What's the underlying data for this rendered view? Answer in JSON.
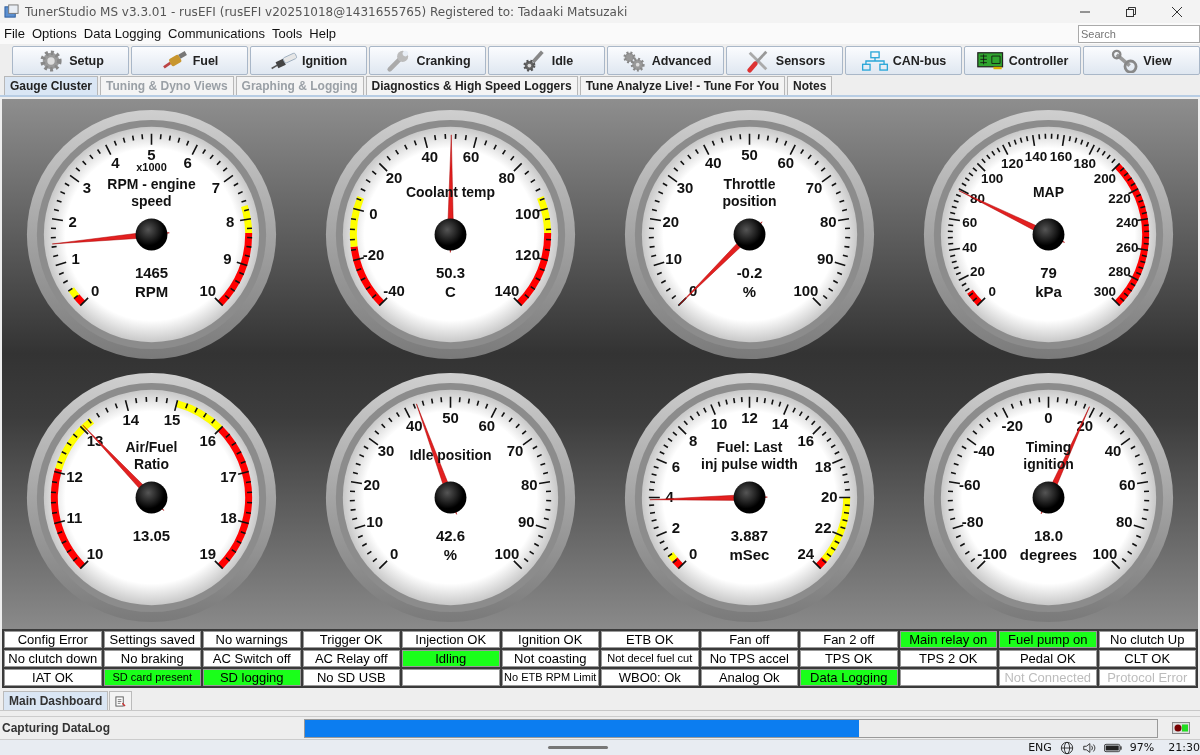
{
  "window": {
    "title": "TunerStudio MS v3.3.01 - rusEFI (rusEFI v20251018@1431655765) Registered to: Tadaaki Matsuzaki"
  },
  "menu": [
    "File",
    "Options",
    "Data Logging",
    "Communications",
    "Tools",
    "Help"
  ],
  "search": {
    "placeholder": "Search"
  },
  "toolbar": [
    {
      "label": "Setup",
      "kind": "gear"
    },
    {
      "label": "Fuel",
      "kind": "injector"
    },
    {
      "label": "Ignition",
      "kind": "sparkplug"
    },
    {
      "label": "Cranking",
      "kind": "wrench"
    },
    {
      "label": "Idle",
      "kind": "wrenchgear"
    },
    {
      "label": "Advanced",
      "kind": "gears"
    },
    {
      "label": "Sensors",
      "kind": "tools"
    },
    {
      "label": "CAN-bus",
      "kind": "network"
    },
    {
      "label": "Controller",
      "kind": "board"
    },
    {
      "label": "View",
      "kind": "conrod"
    }
  ],
  "tabs": [
    {
      "label": "Gauge Cluster",
      "selected": true,
      "disabled": false
    },
    {
      "label": "Tuning & Dyno Views",
      "selected": false,
      "disabled": true
    },
    {
      "label": "Graphing & Logging",
      "selected": false,
      "disabled": true
    },
    {
      "label": "Diagnostics & High Speed Loggers",
      "selected": false,
      "disabled": false
    },
    {
      "label": "Tune Analyze Live! - Tune For You",
      "selected": false,
      "disabled": false
    },
    {
      "label": "Notes",
      "selected": false,
      "disabled": false
    }
  ],
  "gauges": [
    {
      "subtitle": "x1000",
      "lines": [
        "RPM - engine",
        "speed"
      ],
      "value": "1465",
      "unit": "RPM",
      "scale": [
        "0",
        "1",
        "2",
        "3",
        "4",
        "5",
        "6",
        "7",
        "8",
        "9",
        "10"
      ]
    },
    {
      "lines": [
        "Coolant temp"
      ],
      "value": "50.3",
      "unit": "C",
      "scale": [
        "-40",
        "-20",
        "0",
        "20",
        "40",
        "60",
        "80",
        "100",
        "120",
        "140"
      ]
    },
    {
      "lines": [
        "Throttle",
        "position"
      ],
      "value": "-0.2",
      "unit": "%",
      "scale": [
        "0",
        "10",
        "20",
        "30",
        "40",
        "50",
        "60",
        "70",
        "80",
        "90",
        "100"
      ]
    },
    {
      "lines": [
        "MAP"
      ],
      "value": "79",
      "unit": "kPa",
      "scale": [
        "0",
        "20",
        "40",
        "60",
        "80",
        "100",
        "120",
        "140",
        "160",
        "180",
        "200",
        "220",
        "240",
        "260",
        "280",
        "300"
      ]
    },
    {
      "lines": [
        "Air/Fuel",
        "Ratio"
      ],
      "value": "13.05",
      "scale": [
        "10",
        "11",
        "12",
        "13",
        "14",
        "15",
        "16",
        "17",
        "18",
        "19"
      ]
    },
    {
      "lines": [
        "Idle position"
      ],
      "value": "42.6",
      "unit": "%",
      "scale": [
        "0",
        "10",
        "20",
        "30",
        "40",
        "50",
        "60",
        "70",
        "80",
        "90",
        "100"
      ]
    },
    {
      "lines": [
        "Fuel: Last",
        "inj pulse width"
      ],
      "value": "3.887",
      "unit": "mSec",
      "scale": [
        "0",
        "2",
        "4",
        "6",
        "8",
        "10",
        "12",
        "14",
        "16",
        "18",
        "20",
        "22",
        "24"
      ]
    },
    {
      "lines": [
        "Timing",
        "ignition"
      ],
      "value": "18.0",
      "unit": "degrees",
      "scale": [
        "-100",
        "-80",
        "-60",
        "-40",
        "-20",
        "0",
        "20",
        "40",
        "60",
        "80",
        "100"
      ]
    }
  ],
  "indicators": [
    {
      "cells": [
        {
          "text": "Config Error",
          "on": false,
          "disabled": false
        },
        {
          "text": "Settings saved",
          "on": false,
          "disabled": false
        },
        {
          "text": "No warnings",
          "on": false,
          "disabled": false
        },
        {
          "text": "Trigger OK",
          "on": false,
          "disabled": false
        },
        {
          "text": "Injection OK",
          "on": false,
          "disabled": false
        },
        {
          "text": "Ignition OK",
          "on": false,
          "disabled": false
        },
        {
          "text": "ETB OK",
          "on": false,
          "disabled": false
        },
        {
          "text": "Fan off",
          "on": false,
          "disabled": false
        },
        {
          "text": "Fan 2 off",
          "on": false,
          "disabled": false
        },
        {
          "text": "Main relay on",
          "on": true,
          "disabled": false
        },
        {
          "text": "Fuel pump on",
          "on": true,
          "disabled": false
        },
        {
          "text": "No clutch Up",
          "on": false,
          "disabled": false
        }
      ]
    },
    {
      "cells": [
        {
          "text": "No clutch down",
          "on": false,
          "disabled": false
        },
        {
          "text": "No braking",
          "on": false,
          "disabled": false
        },
        {
          "text": "AC Switch off",
          "on": false,
          "disabled": false
        },
        {
          "text": "AC Relay off",
          "on": false,
          "disabled": false
        },
        {
          "text": "Idling",
          "on": true,
          "disabled": false
        },
        {
          "text": "Not coasting",
          "on": false,
          "disabled": false
        },
        {
          "text": "Not decel fuel cut",
          "on": false,
          "disabled": false
        },
        {
          "text": "No TPS accel",
          "on": false,
          "disabled": false
        },
        {
          "text": "TPS OK",
          "on": false,
          "disabled": false
        },
        {
          "text": "TPS 2 OK",
          "on": false,
          "disabled": false
        },
        {
          "text": "Pedal OK",
          "on": false,
          "disabled": false
        },
        {
          "text": "CLT OK",
          "on": false,
          "disabled": false
        }
      ]
    },
    {
      "cells": [
        {
          "text": "IAT OK",
          "on": false,
          "disabled": false
        },
        {
          "text": "SD card present",
          "on": true,
          "disabled": false
        },
        {
          "text": "SD logging",
          "on": true,
          "disabled": false
        },
        {
          "text": "No SD USB",
          "on": false,
          "disabled": false
        },
        {
          "on": false
        },
        {
          "text": "No ETB RPM Limit",
          "on": false,
          "disabled": false
        },
        {
          "text": "WBO0: Ok",
          "on": false,
          "disabled": false
        },
        {
          "text": "Analog Ok",
          "on": false,
          "disabled": false
        },
        {
          "text": "Data Logging",
          "on": true,
          "disabled": false
        },
        {
          "on": false
        },
        {
          "text": "Not Connected",
          "on": false,
          "disabled": true
        },
        {
          "text": "Protocol Error",
          "on": false,
          "disabled": true
        }
      ]
    }
  ],
  "dashboard_tabs": [
    {
      "label": "Main Dashboard",
      "kind": "text",
      "selected": true
    },
    {
      "kind": "icon",
      "selected": false
    }
  ],
  "status_bar": {
    "message": "Capturing DataLog",
    "level": 0.65
  },
  "taskbar": {
    "language": "ENG",
    "battery": "97%",
    "time": "21:30"
  }
}
